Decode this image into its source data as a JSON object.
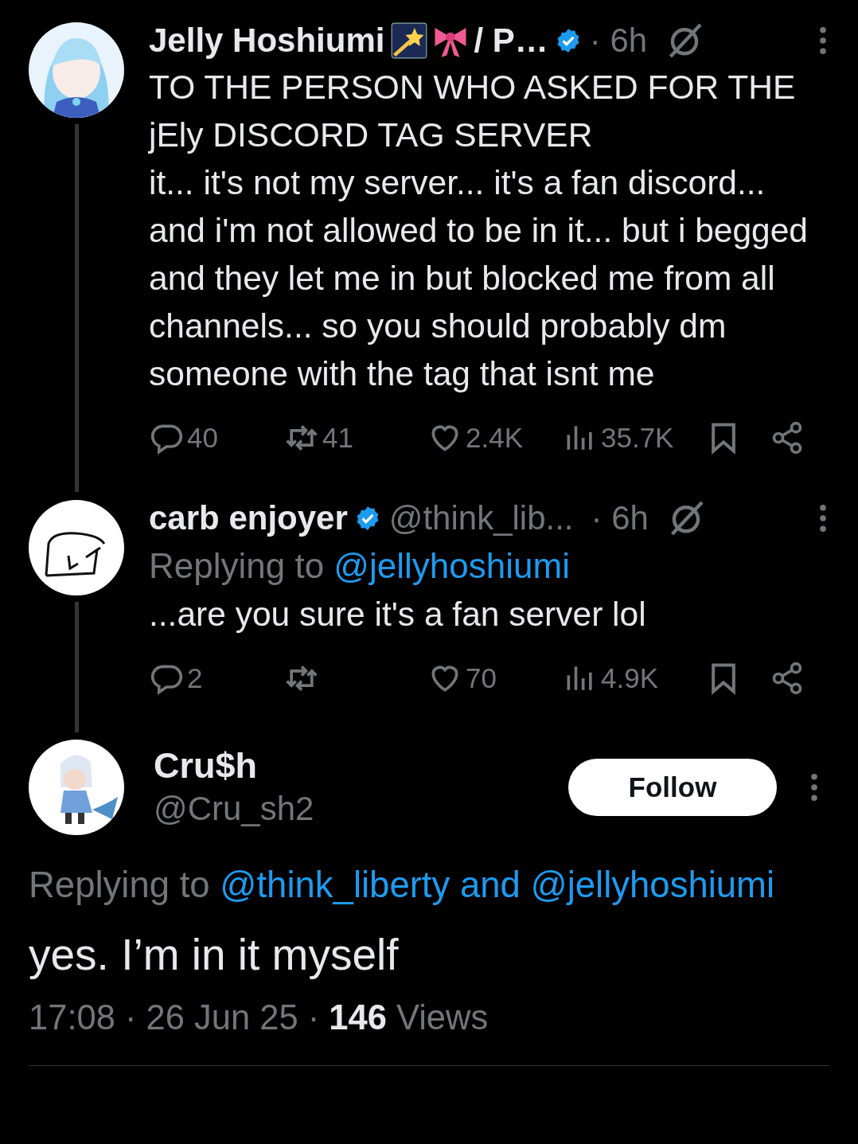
{
  "thread": [
    {
      "name": "Jelly Hoshiumi",
      "name_suffix": "/ P…",
      "verified": true,
      "time": "· 6h",
      "body": [
        "TO THE PERSON WHO ASKED FOR THE jEly DISCORD TAG SERVER",
        "it... it's not my server... it's a fan discord... and i'm not allowed to be in it... but i begged and they let me in but blocked me from all channels... so you should probably dm someone with the tag that isnt me"
      ],
      "stats": {
        "replies": "40",
        "reposts": "41",
        "likes": "2.4K",
        "views": "35.7K"
      }
    },
    {
      "name": "carb enjoyer",
      "verified": true,
      "handle": "@think_lib...",
      "time": "· 6h",
      "replying_to": {
        "prefix": "Replying to",
        "users": "@jellyhoshiumi"
      },
      "body": [
        "...are you sure it's a fan server lol"
      ],
      "stats": {
        "replies": "2",
        "likes": "70",
        "views": "4.9K"
      }
    }
  ],
  "main": {
    "name": "Cru$h",
    "handle": "@Cru_sh2",
    "follow_button": "Follow",
    "replying_to": {
      "prefix": "Replying to",
      "users": "@think_liberty and @jellyhoshiumi"
    },
    "body": "yes. I’m in it myself",
    "time": "17:08 · 26 Jun 25 · ",
    "views_count": "146",
    "views_label": "Views"
  }
}
